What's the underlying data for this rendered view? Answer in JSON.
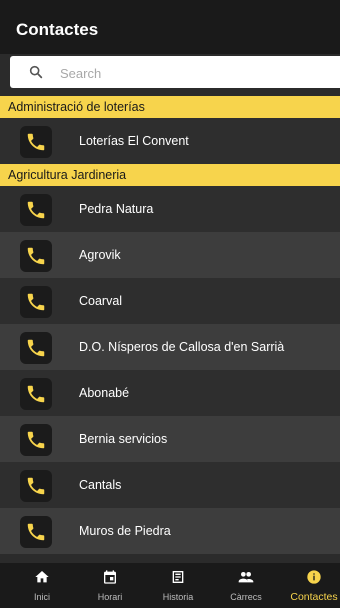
{
  "header": {
    "title": "Contactes"
  },
  "search": {
    "placeholder": "Search",
    "value": ""
  },
  "sections": [
    {
      "title": "Administració de loterías",
      "contacts": [
        "Loterías El Convent"
      ]
    },
    {
      "title": "Agricultura Jardineria",
      "contacts": [
        "Pedra Natura",
        "Agrovik",
        "Coarval",
        "D.O. Nísperos de Callosa d'en Sarrià",
        "Abonabé",
        "Bernia servicios",
        "Cantals",
        "Muros de Piedra"
      ]
    }
  ],
  "contact_icon": "phone-icon",
  "colors": {
    "accent": "#f7d44c",
    "header_bg": "#1a1a1a",
    "row_dark": "#2e2e2e",
    "row_light": "#3d3d3d"
  },
  "tabbar": {
    "tabs": [
      {
        "label": "Inici",
        "icon": "home-icon",
        "active": false
      },
      {
        "label": "Horari",
        "icon": "calendar-icon",
        "active": false
      },
      {
        "label": "Historia",
        "icon": "newspaper-icon",
        "active": false
      },
      {
        "label": "Càrrecs",
        "icon": "people-icon",
        "active": false
      },
      {
        "label": "Contactes",
        "icon": "info-icon",
        "active": true
      }
    ]
  }
}
